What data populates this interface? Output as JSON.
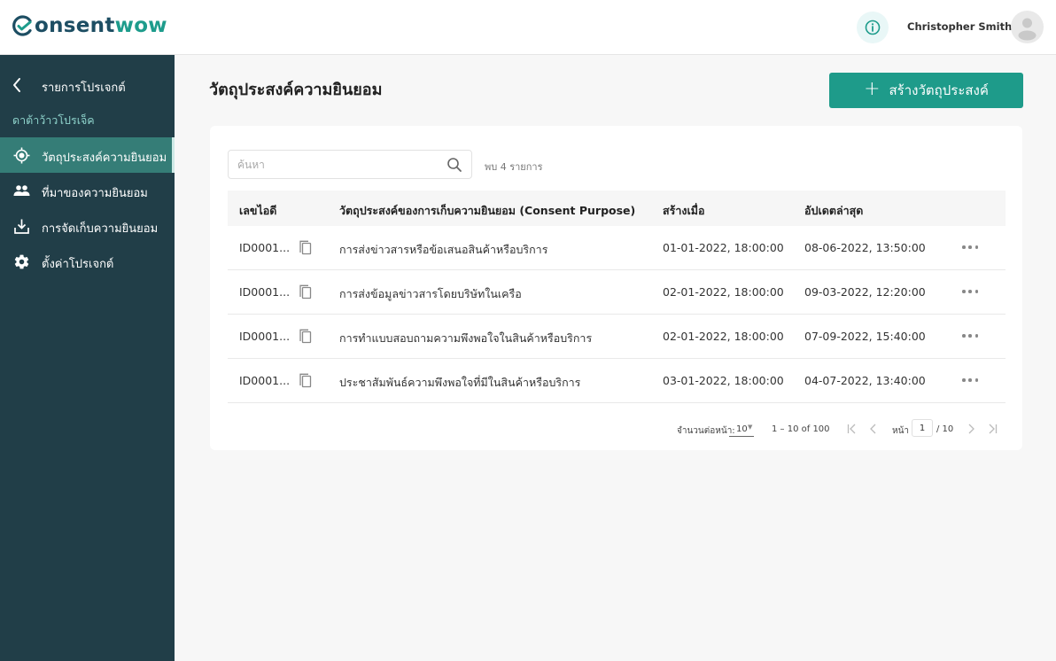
{
  "brand": {
    "name_part1": "onsent",
    "name_part2": "wow",
    "primary_color": "#1d4e63",
    "accent_color": "#1e9c8c"
  },
  "header": {
    "user_name": "Christopher Smith",
    "info_icon": "info-icon",
    "avatar_icon": "user-avatar-icon"
  },
  "sidebar": {
    "back_label": "รายการโปรเจกต์",
    "project_name": "ดาต้าว้าวโปรเจ็ค",
    "items": [
      {
        "label": "วัตถุประสงค์ความยินยอม",
        "icon": "target-icon",
        "active": true
      },
      {
        "label": "ที่มาของความยินยอม",
        "icon": "people-icon",
        "active": false
      },
      {
        "label": "การจัดเก็บความยินยอม",
        "icon": "download-icon",
        "active": false
      },
      {
        "label": "ตั้งค่าโปรเจกต์",
        "icon": "gear-icon",
        "active": false
      }
    ]
  },
  "main": {
    "title": "วัตถุประสงค์ความยินยอม",
    "create_button_label": "สร้างวัตถุประสงค์",
    "search": {
      "placeholder": "ค้นหา",
      "value": ""
    },
    "result_count": "พบ 4 รายการ",
    "table": {
      "columns": [
        "เลขไอดี",
        "วัตถุประสงค์ของการเก็บความยินยอม (Consent Purpose)",
        "สร้างเมื่อ",
        "อัปเดตล่าสุด"
      ],
      "rows": [
        {
          "id": "ID0001...",
          "purpose": "การส่งข่าวสารหรือข้อเสนอสินค้าหรือบริการ",
          "created": "01-01-2022, 18:00:00",
          "updated": "08-06-2022, 13:50:00"
        },
        {
          "id": "ID0001...",
          "purpose": "การส่งข้อมูลข่าวสารโดยบริษัทในเครือ",
          "created": "02-01-2022, 18:00:00",
          "updated": "09-03-2022, 12:20:00"
        },
        {
          "id": "ID0001...",
          "purpose": "การทำแบบสอบถามความพึงพอใจในสินค้าหรือบริการ",
          "created": "02-01-2022, 18:00:00",
          "updated": "07-09-2022, 15:40:00"
        },
        {
          "id": "ID0001...",
          "purpose": "ประชาสัมพันธ์ความพึงพอใจที่มีในสินค้าหรือบริการ",
          "created": "03-01-2022, 18:00:00",
          "updated": "04-07-2022, 13:40:00"
        }
      ]
    },
    "pagination": {
      "rows_per_page_label": "จำนวนต่อหน้า:",
      "rows_per_page": "10",
      "range": "1 – 10 of 100",
      "page_label": "หน้า",
      "current_page": "1",
      "total_pages": "/ 10"
    }
  }
}
